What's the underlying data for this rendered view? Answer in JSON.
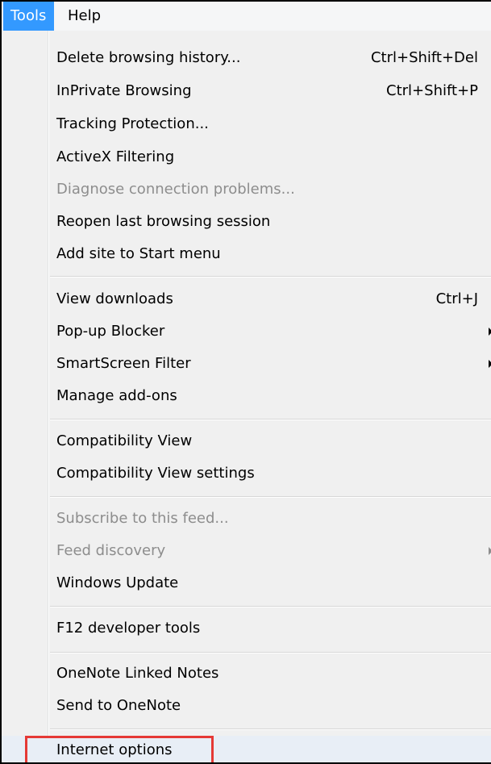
{
  "menubar": {
    "tools": "Tools",
    "help": "Help"
  },
  "menu": {
    "items": [
      {
        "label": "Delete browsing history...",
        "shortcut": "Ctrl+Shift+Del"
      },
      {
        "label": "InPrivate Browsing",
        "shortcut": "Ctrl+Shift+P"
      },
      {
        "label": "Tracking Protection..."
      },
      {
        "label": "ActiveX Filtering"
      },
      {
        "label": "Diagnose connection problems...",
        "disabled": true
      },
      {
        "label": "Reopen last browsing session"
      },
      {
        "label": "Add site to Start menu"
      },
      {
        "label": "View downloads",
        "shortcut": "Ctrl+J"
      },
      {
        "label": "Pop-up Blocker",
        "submenu": true
      },
      {
        "label": "SmartScreen Filter",
        "submenu": true
      },
      {
        "label": "Manage add-ons"
      },
      {
        "label": "Compatibility View"
      },
      {
        "label": "Compatibility View settings"
      },
      {
        "label": "Subscribe to this feed...",
        "disabled": true
      },
      {
        "label": "Feed discovery",
        "disabled": true,
        "submenu": true
      },
      {
        "label": "Windows Update"
      },
      {
        "label": "F12 developer tools"
      },
      {
        "label": "OneNote Linked Notes"
      },
      {
        "label": "Send to OneNote"
      },
      {
        "label": "Internet options"
      }
    ]
  },
  "colors": {
    "menu_highlight": "#3399ff",
    "disabled_text": "#8d8d8d",
    "callout_border": "#e53935"
  }
}
